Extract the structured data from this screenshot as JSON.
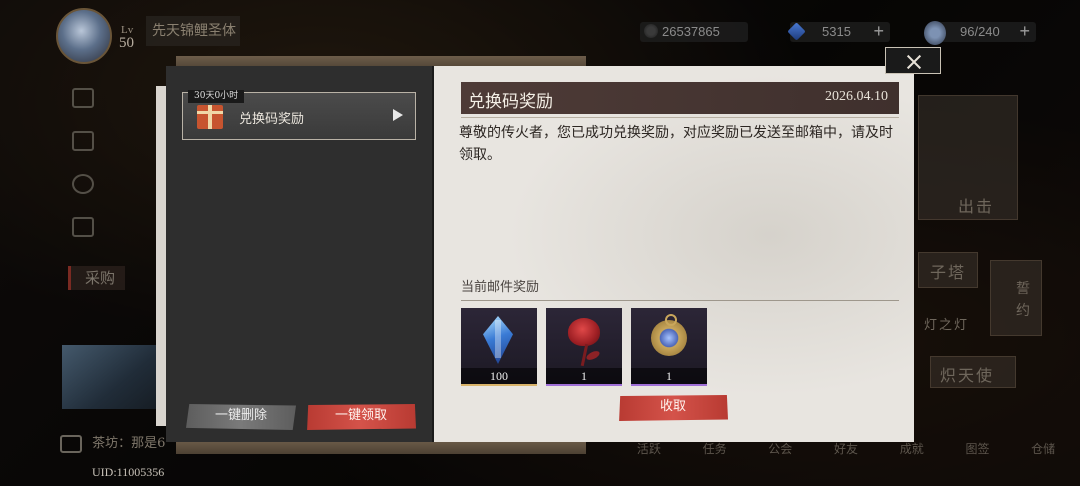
{
  "player": {
    "level_label": "Lv",
    "level": "50",
    "name": "先天锦鲤圣体",
    "uid": "UID:11005356"
  },
  "resources": {
    "gold": {
      "value": "26537865",
      "icon": "coin-icon"
    },
    "gems": {
      "value": "5315",
      "icon": "gem-icon"
    },
    "stamina": {
      "value": "96/240",
      "icon": "stamina-icon"
    }
  },
  "background": {
    "purchase_label": "采购",
    "chat_prefix": "茶坊：那是6",
    "right_cards": [
      "出击",
      "子塔",
      "誓约",
      "灯之灯",
      "炽天使"
    ],
    "bottom_nav": [
      "活跃",
      "任务",
      "公会",
      "好友",
      "成就",
      "图签",
      "仓储"
    ]
  },
  "mail": {
    "selected": {
      "timer": "30天0小时",
      "title": "兑换码奖励"
    },
    "buttons": {
      "delete_all": "一键删除",
      "claim_all": "一键领取"
    },
    "detail": {
      "title": "兑换码奖励",
      "date": "2026.04.10",
      "body": "尊敬的传火者，您已成功兑换奖励，对应奖励已发送至邮箱中，请及时领取。",
      "rewards_label": "当前邮件奖励",
      "rewards": [
        {
          "icon": "crystal-icon",
          "count": "100"
        },
        {
          "icon": "rose-icon",
          "count": "1"
        },
        {
          "icon": "pocket-watch-icon",
          "count": "1"
        }
      ],
      "claim_label": "收取"
    }
  }
}
